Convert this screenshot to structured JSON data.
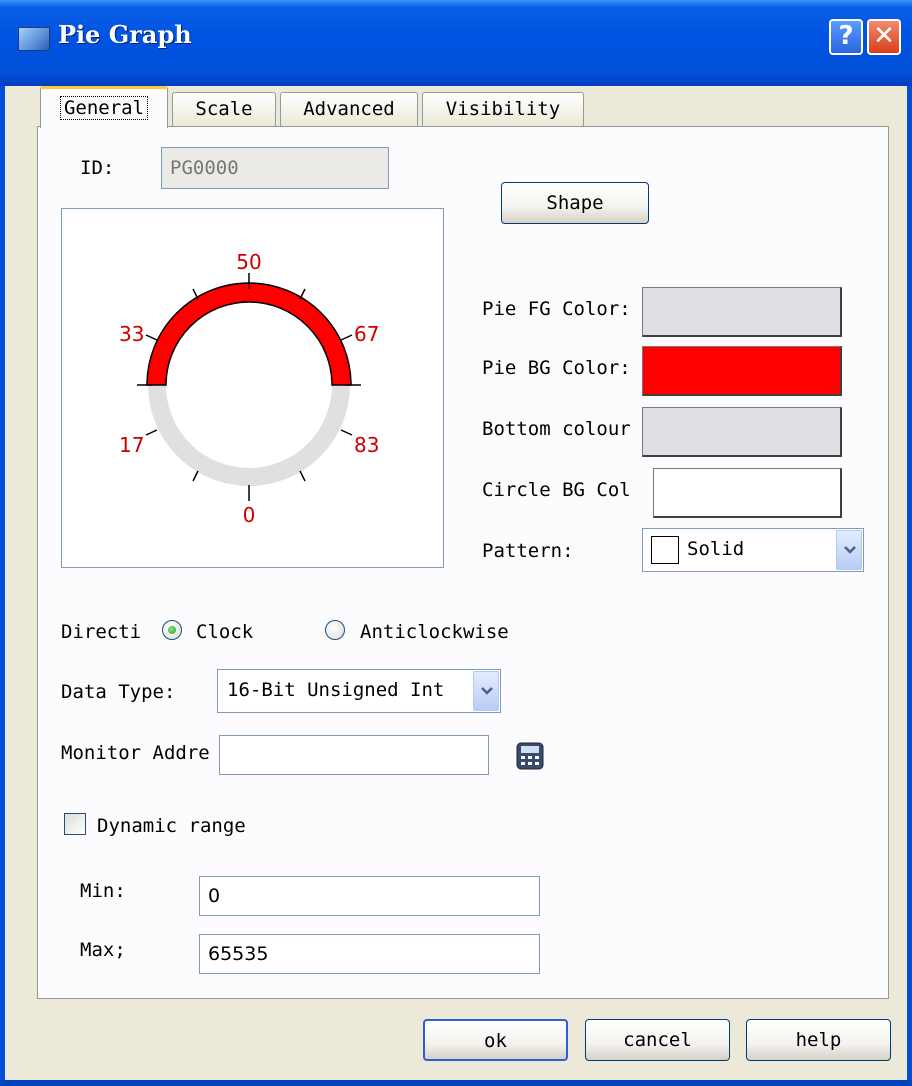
{
  "window": {
    "title": "Pie Graph",
    "help_glyph": "?",
    "close_glyph": "✕"
  },
  "tabs": [
    {
      "label": "General",
      "active": true
    },
    {
      "label": "Scale",
      "active": false
    },
    {
      "label": "Advanced",
      "active": false
    },
    {
      "label": "Visibility",
      "active": false
    }
  ],
  "general": {
    "id_label": "ID:",
    "id_value": "PG0000",
    "shape_button": "Shape",
    "preview": {
      "scale_labels": [
        "50",
        "33",
        "67",
        "17",
        "83",
        "0"
      ],
      "arc_color": "#ff0000",
      "ring_color": "#e0e0e0",
      "label_color": "#cc0000"
    },
    "pie_fg_label": "Pie FG Color:",
    "pie_fg_color": "#e0dfe3",
    "pie_bg_label": "Pie BG Color:",
    "pie_bg_color": "#ff0000",
    "bottom_colour_label": "Bottom colour",
    "bottom_colour": "#e0dfe3",
    "circle_bg_label": "Circle BG Col",
    "circle_bg_color": "#ffffff",
    "pattern_label": "Pattern:",
    "pattern_value": "Solid",
    "direction_label": "Directi",
    "direction_options": [
      "Clock",
      "Anticlockwise"
    ],
    "direction_selected": "Clock",
    "data_type_label": "Data Type:",
    "data_type_value": "16-Bit Unsigned Int",
    "monitor_label": "Monitor Addre",
    "monitor_value": "",
    "dynamic_range_label": "Dynamic range",
    "dynamic_range_checked": false,
    "min_label": "Min:",
    "min_value": "0",
    "max_label": "Max;",
    "max_value": "65535"
  },
  "footer": {
    "ok": "ok",
    "cancel": "cancel",
    "help": "help"
  }
}
